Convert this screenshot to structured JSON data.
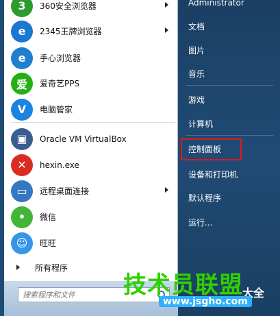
{
  "left_programs": [
    {
      "label": "360安全浏览器",
      "icon": "360-browser-icon",
      "color": "#2e9b2e",
      "glyph": "3",
      "has_arrow": true
    },
    {
      "label": "2345王牌浏览器",
      "icon": "2345-browser-icon",
      "color": "#1a78d2",
      "glyph": "e",
      "has_arrow": true
    },
    {
      "label": "手心浏览器",
      "icon": "shouxin-browser-icon",
      "color": "#1f7fd1",
      "glyph": "e",
      "has_arrow": false
    },
    {
      "label": "爱奇艺PPS",
      "icon": "iqiyi-pps-icon",
      "color": "#24b014",
      "glyph": "爱",
      "has_arrow": false
    },
    {
      "label": "电脑管家",
      "icon": "pc-manager-icon",
      "color": "#1a84e0",
      "glyph": "V",
      "has_arrow": false
    },
    {
      "label": "Oracle VM VirtualBox",
      "icon": "virtualbox-icon",
      "color": "#3b5c8f",
      "glyph": "▣",
      "has_arrow": false
    },
    {
      "label": "hexin.exe",
      "icon": "hexin-icon",
      "color": "#d82c22",
      "glyph": "✕",
      "has_arrow": false
    },
    {
      "label": "远程桌面连接",
      "icon": "remote-desktop-icon",
      "color": "#3478c4",
      "glyph": "▭",
      "has_arrow": true
    },
    {
      "label": "微信",
      "icon": "wechat-icon",
      "color": "#42b537",
      "glyph": "•",
      "has_arrow": false
    },
    {
      "label": "旺旺",
      "icon": "wangwang-icon",
      "color": "#3596e6",
      "glyph": "☺",
      "has_arrow": false
    }
  ],
  "all_programs_label": "所有程序",
  "search": {
    "placeholder": "搜索程序和文件"
  },
  "right_items": {
    "user": "Administrator",
    "documents": "文档",
    "pictures": "图片",
    "music": "音乐",
    "games": "游戏",
    "computer": "计算机",
    "control_panel": "控制面板",
    "devices_printers": "设备和打印机",
    "default_programs": "默认程序",
    "run": "运行..."
  },
  "watermark": {
    "main": "技术员联盟",
    "sub": "大全",
    "url": "www.jsgho.com"
  },
  "colors": {
    "highlight": "#e01818",
    "right_pane": "#204b75",
    "watermark_green": "#2fd000"
  }
}
